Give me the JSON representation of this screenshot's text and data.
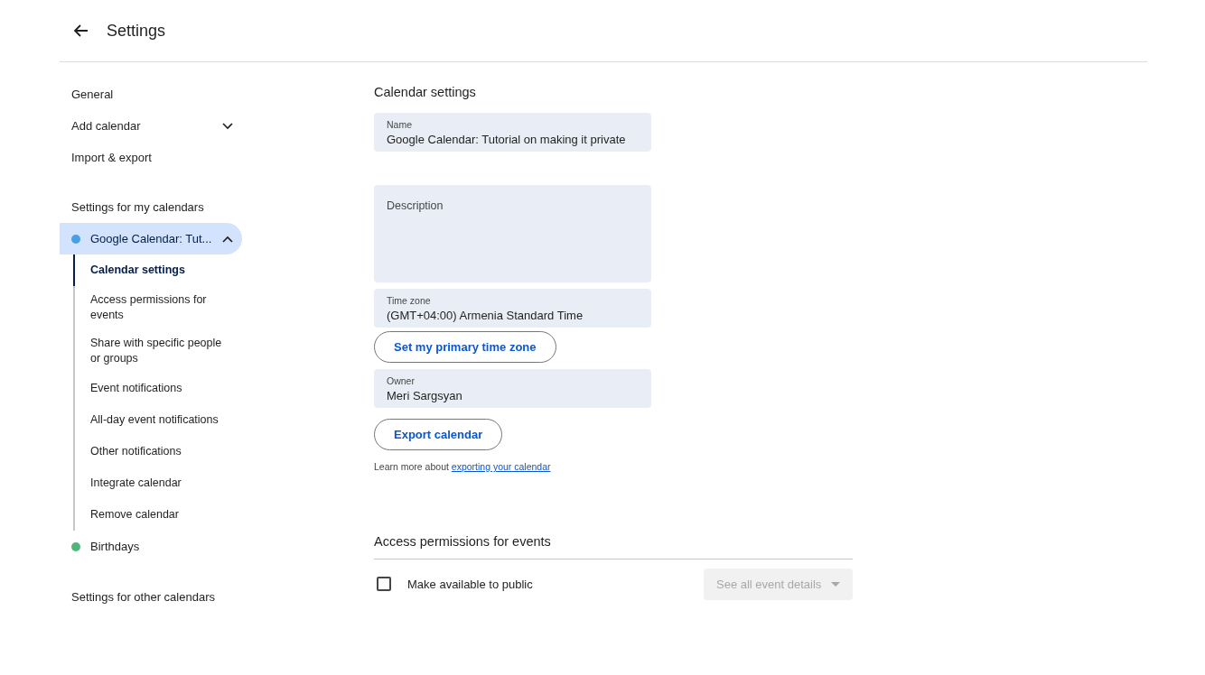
{
  "header": {
    "title": "Settings"
  },
  "sidebar": {
    "items": [
      {
        "label": "General",
        "kind": "link"
      },
      {
        "label": "Add calendar",
        "kind": "dropdown",
        "expanded": false
      },
      {
        "label": "Import & export",
        "kind": "link"
      }
    ],
    "my_calendars": {
      "heading": "Settings for my calendars",
      "calendars": [
        {
          "name": "Google Calendar: Tut...",
          "color": "#4a9ee8",
          "selected": true,
          "expanded": true,
          "children": [
            {
              "label": "Calendar settings",
              "selected": true
            },
            {
              "label": "Access permissions for events",
              "selected": false
            },
            {
              "label": "Share with specific people or groups",
              "selected": false
            },
            {
              "label": "Event notifications",
              "selected": false
            },
            {
              "label": "All-day event notifications",
              "selected": false
            },
            {
              "label": "Other notifications",
              "selected": false
            },
            {
              "label": "Integrate calendar",
              "selected": false
            },
            {
              "label": "Remove calendar",
              "selected": false
            }
          ]
        },
        {
          "name": "Birthdays",
          "color": "#4fb67a",
          "selected": false,
          "expanded": false
        }
      ]
    },
    "other_calendars": {
      "heading": "Settings for other calendars"
    }
  },
  "calendar_settings": {
    "heading": "Calendar settings",
    "blocks": [
      {
        "kind": "field",
        "label": "Name",
        "value": "Google Calendar: Tutorial on making it private"
      },
      {
        "kind": "textarea",
        "placeholder": "Description"
      },
      {
        "kind": "field",
        "label": "Time zone",
        "value": "(GMT+04:00) Armenia Standard Time"
      },
      {
        "kind": "button",
        "label": "Set my primary time zone"
      },
      {
        "kind": "field",
        "label": "Owner",
        "value": "Meri Sargsyan"
      },
      {
        "kind": "button",
        "label": "Export calendar"
      },
      {
        "kind": "note",
        "text": "Learn more about",
        "link": "exporting your calendar"
      }
    ]
  },
  "access_permissions": {
    "heading": "Access permissions for events",
    "public": {
      "label": "Make available to public",
      "checked": false
    },
    "visibility": {
      "value": "See all event details",
      "disabled": true
    }
  }
}
